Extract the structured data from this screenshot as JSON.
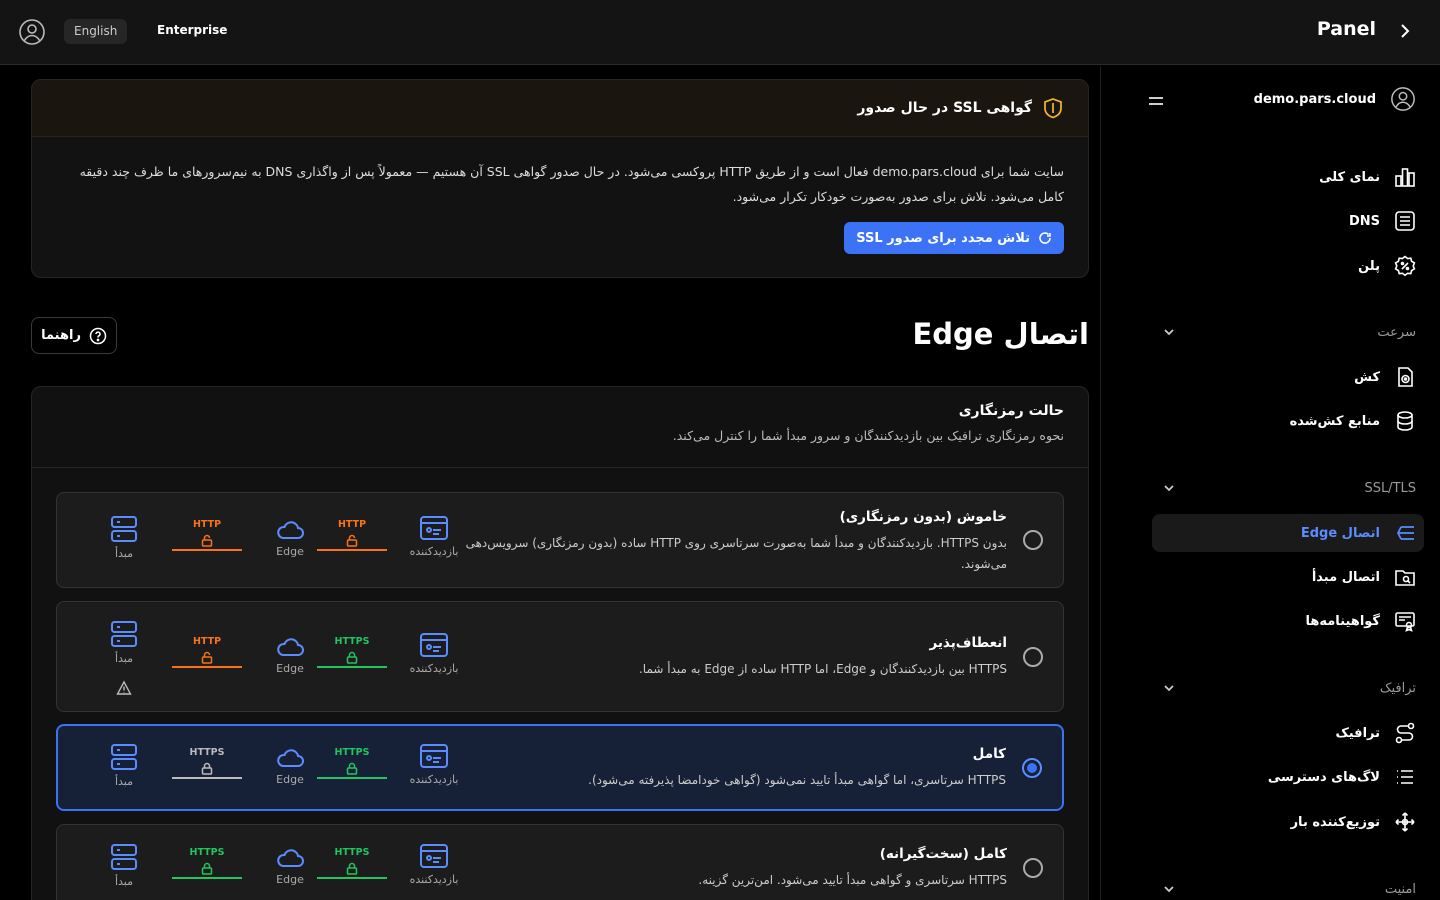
{
  "topbar": {
    "language": "English",
    "plan_badge": "Enterprise",
    "panel_title": "Panel"
  },
  "sidebar": {
    "domain": "demo.pars.cloud",
    "items_top": [
      {
        "label": "نمای کلی",
        "icon": "chart-icon"
      },
      {
        "label": "DNS",
        "icon": "list-icon"
      },
      {
        "label": "پلن",
        "icon": "badge-icon"
      }
    ],
    "sections": [
      {
        "title": "سرعت",
        "items": [
          {
            "label": "کش",
            "icon": "cache-icon"
          },
          {
            "label": "منابع کش‌شده",
            "icon": "database-icon"
          }
        ]
      },
      {
        "title": "SSL/TLS",
        "items": [
          {
            "label": "اتصال Edge",
            "icon": "edge-icon",
            "active": true
          },
          {
            "label": "اتصال مبدأ",
            "icon": "folder-icon"
          },
          {
            "label": "گواهینامه‌ها",
            "icon": "certificate-icon"
          }
        ]
      },
      {
        "title": "ترافیک",
        "items": [
          {
            "label": "ترافیک",
            "icon": "route-icon"
          },
          {
            "label": "لاگ‌های دسترسی",
            "icon": "logs-icon"
          },
          {
            "label": "توزیع‌کننده بار",
            "icon": "load-balancer-icon"
          }
        ]
      },
      {
        "title": "امنیت",
        "items": []
      }
    ]
  },
  "ssl_notice": {
    "title": "گواهی SSL در حال صدور",
    "body_line1": "سایت شما برای demo.pars.cloud فعال است و از طریق HTTP پروکسی می‌شود. در حال صدور گواهی SSL آن هستیم — معمولاً پس از واگذاری DNS به نیم‌سرورهای ما ظرف چند دقیقه",
    "body_line2": "کامل می‌شود. تلاش برای صدور به‌صورت خودکار تکرار می‌شود.",
    "retry_label": "تلاش مجدد برای صدور SSL"
  },
  "page": {
    "title": "اتصال Edge",
    "guide_label": "راهنما"
  },
  "encryption": {
    "title": "حالت رمزنگاری",
    "description": "نحوه رمزنگاری ترافیک بین بازدیدکنندگان و سرور مبدأ شما را کنترل می‌کند.",
    "node_labels": {
      "visitor": "بازدیدکننده",
      "edge": "Edge",
      "origin": "مبدأ"
    },
    "colors": {
      "http": "#f97316",
      "https": "#22c55e",
      "neutral": "#bbbbbb",
      "accent": "#3b72f6"
    },
    "options": [
      {
        "title": "خاموش (بدون رمزنگاری)",
        "desc_line1": "بدون HTTPS. بازدیدکنندگان و مبدأ شما به‌صورت سرتاسری روی HTTP ساده (بدون رمزنگاری) سرویس‌دهی",
        "desc_line2": "می‌شوند.",
        "left_proto": "HTTP",
        "right_proto": "HTTP",
        "selected": false
      },
      {
        "title": "انعطاف‌پذیر",
        "desc_line1": "HTTPS بین بازدیدکنندگان و Edge، اما HTTP ساده از Edge به مبدأ شما.",
        "desc_line2": "",
        "left_proto": "HTTPS",
        "right_proto": "HTTP",
        "selected": false,
        "warning": true
      },
      {
        "title": "کامل",
        "desc_line1": "HTTPS سرتاسری، اما گواهی مبدأ تایید نمی‌شود (گواهی خودامضا پذیرفته می‌شود).",
        "desc_line2": "",
        "left_proto": "HTTPS",
        "right_proto": "HTTPS",
        "selected": true
      },
      {
        "title": "کامل (سخت‌گیرانه)",
        "desc_line1": "HTTPS سرتاسری و گواهی مبدأ تایید می‌شود. امن‌ترین گزینه.",
        "desc_line2": "",
        "left_proto": "HTTPS",
        "right_proto": "HTTPS",
        "selected": false
      }
    ]
  }
}
